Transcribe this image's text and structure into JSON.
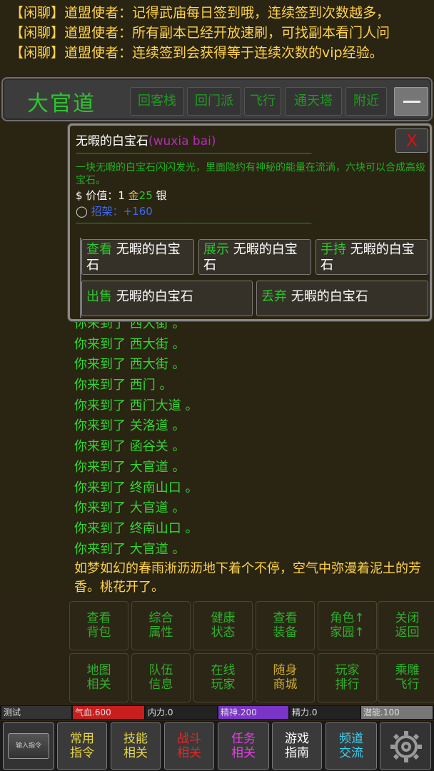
{
  "chat": [
    {
      "channel": "【闲聊】",
      "name": "道盟使者：",
      "message": "记得武庙每日签到哦，连续签到次数越多，"
    },
    {
      "channel": "【闲聊】",
      "name": "道盟使者：",
      "message": "所有副本已经开放速刷，可找副本看门人问"
    },
    {
      "channel": "【闲聊】",
      "name": "道盟使者：",
      "message": "连续签到会获得等于连续次数的vip经验。"
    }
  ],
  "location": {
    "title": "大官道",
    "buttons": [
      "回客栈",
      "回门派",
      "飞行",
      "通天塔",
      "附近"
    ]
  },
  "popup": {
    "name": "无暇的白宝石",
    "en_name": "(wuxia bai)",
    "close": "X",
    "divider": "——————————————————————————————",
    "description": "一块无暇的白宝石闪闪发光，里面隐约有神秘的能量在流淌，六块可以合成高级宝石。",
    "value_label": "$ 价值：",
    "value_gold_num": "1",
    "value_gold": "金",
    "value_silver_num": "25",
    "value_silver": "银",
    "parry_prefix": "◯",
    "parry_label": "招架：",
    "parry_value": "+160",
    "actions": [
      {
        "verb": "查看",
        "item": " 无暇的白宝石"
      },
      {
        "verb": "展示",
        "item": " 无暇的白宝石"
      },
      {
        "verb": "手持",
        "item": " 无暇的白宝石"
      },
      {
        "verb": "出售",
        "item": " 无暇的白宝石"
      },
      {
        "verb": "丢弃",
        "item": " 无暇的白宝石"
      }
    ]
  },
  "log": [
    "你来到了 西大街 。",
    "你来到了 西大街 。",
    "你来到了 西大街 。",
    "你来到了 西门 。",
    "你来到了 西门大道 。",
    "你来到了 关洛道 。",
    "你来到了 函谷关 。",
    "你来到了 大官道 。",
    "你来到了 终南山口 。",
    "你来到了 大官道 。",
    "你来到了 终南山口 。",
    "你来到了 大官道 。"
  ],
  "weather": "如梦如幻的春雨淅沥沥地下着个不停，空气中弥漫着泥土的芳香。桃花开了。",
  "commands": [
    [
      "查看",
      "背包"
    ],
    [
      "综合",
      "属性"
    ],
    [
      "健康",
      "状态"
    ],
    [
      "查看",
      "装备"
    ],
    [
      "角色↑",
      "家园↑"
    ],
    [
      "关闭",
      "返回"
    ],
    [
      "地图",
      "相关"
    ],
    [
      "队伍",
      "信息"
    ],
    [
      "在线",
      "玩家"
    ],
    [
      "随身",
      "商城"
    ],
    [
      "玩家",
      "排行"
    ],
    [
      "乘雕",
      "飞行"
    ]
  ],
  "status": {
    "name": "测试",
    "hp": "气血.600",
    "neili": "内力.0",
    "spirit": "精神.200",
    "jingli": "精力.0",
    "potential": "潜能.100",
    "colors": {
      "hp": "#c81e1e",
      "spirit": "#7a35c8",
      "potential": "#777777"
    }
  },
  "tabs": {
    "input": "输入指令",
    "items": [
      {
        "l1": "常用",
        "l2": "指令",
        "color": "#e8d84a"
      },
      {
        "l1": "技能",
        "l2": "相关",
        "color": "#e8d84a"
      },
      {
        "l1": "战斗",
        "l2": "相关",
        "color": "#e02a2a"
      },
      {
        "l1": "任务",
        "l2": "相关",
        "color": "#e040e0"
      },
      {
        "l1": "游戏",
        "l2": "指南",
        "color": "#ffffff"
      },
      {
        "l1": "频道",
        "l2": "交流",
        "color": "#40d0f0"
      }
    ]
  }
}
